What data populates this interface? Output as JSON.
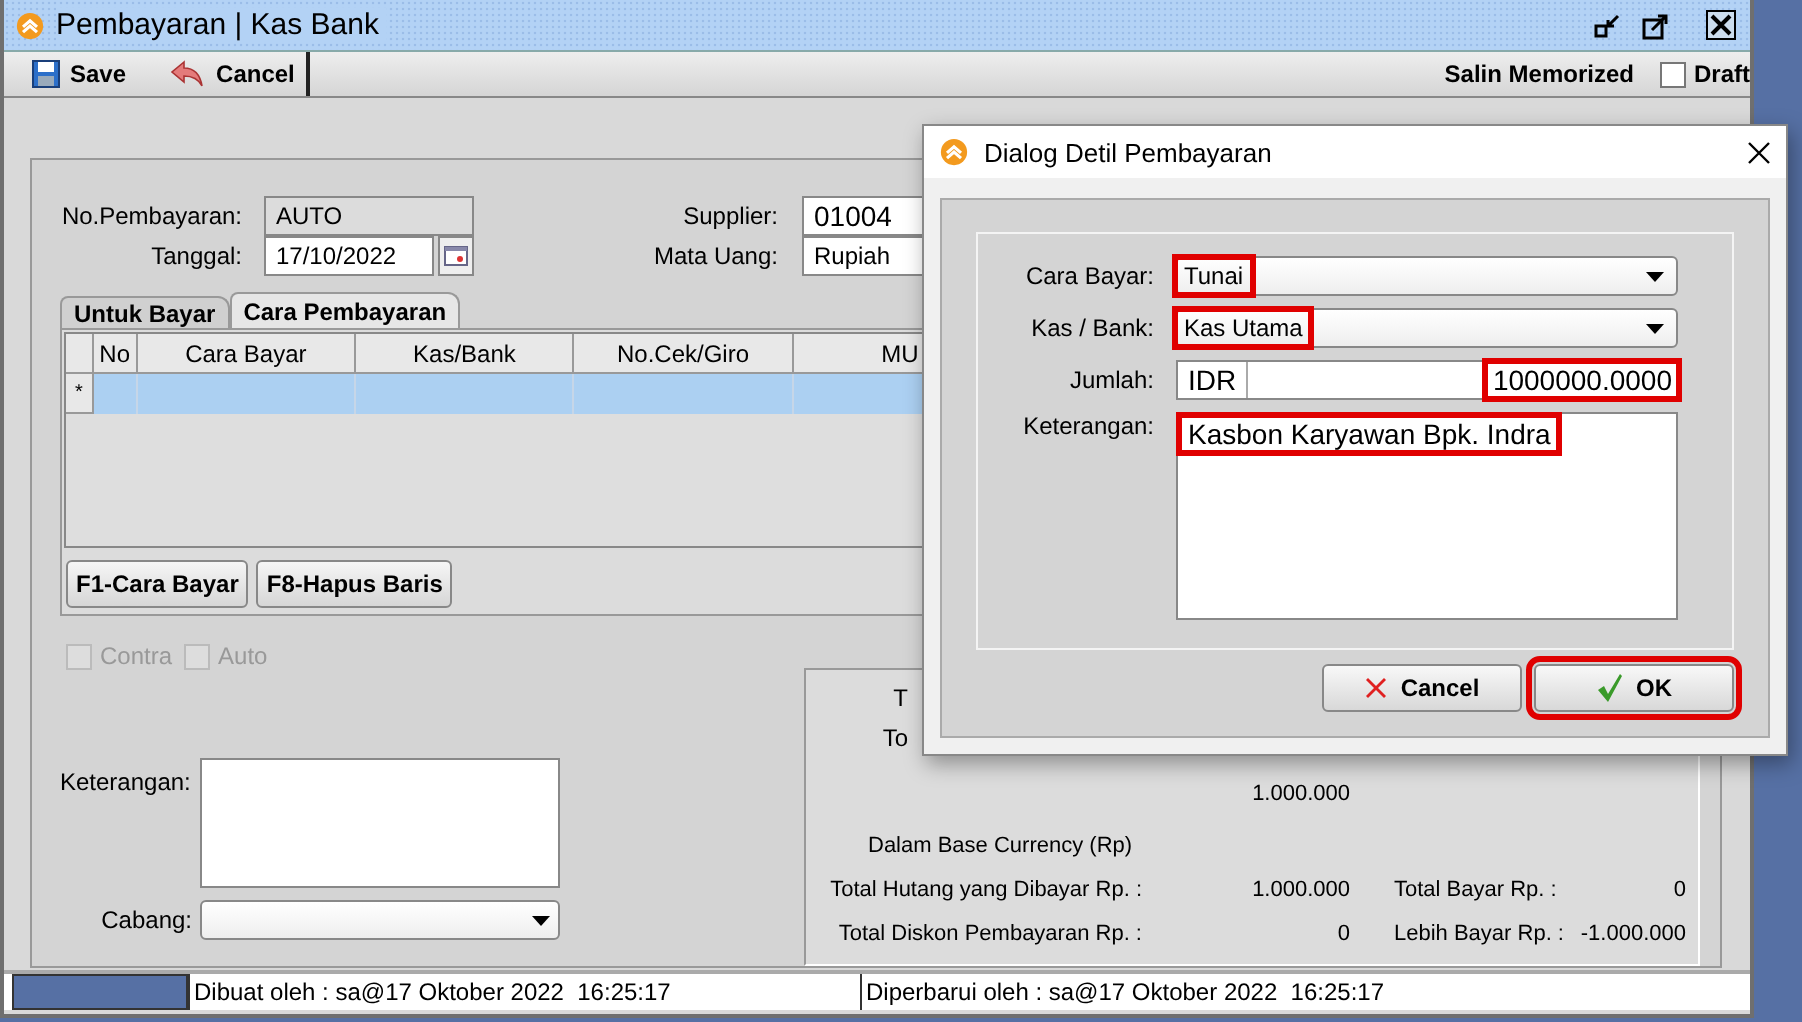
{
  "window": {
    "title": "Pembayaran | Kas Bank"
  },
  "toolbar": [
    {
      "label": "Save",
      "kind": "save"
    },
    {
      "label": "Cancel",
      "kind": "cancel"
    }
  ],
  "salin": "Salin Memorized",
  "draft": {
    "label": "Draft",
    "checked": false
  },
  "form": {
    "no_pembayaran": {
      "label": "No.Pembayaran:",
      "value": "AUTO"
    },
    "tanggal": {
      "label": "Tanggal:",
      "value": "17/10/2022"
    },
    "supplier": {
      "label": "Supplier:",
      "value": "01004"
    },
    "mata_uang": {
      "label": "Mata Uang:",
      "value": "Rupiah"
    }
  },
  "tabs": [
    {
      "label": "Untuk Bayar",
      "selected": false
    },
    {
      "label": "Cara Pembayaran",
      "selected": true
    }
  ],
  "table": {
    "columns": [
      "No",
      "Cara Bayar",
      "Kas/Bank",
      "No.Cek/Giro",
      "MU"
    ],
    "new_row_marker": "*"
  },
  "grid_buttons": [
    "F1-Cara Bayar",
    "F8-Hapus Baris"
  ],
  "options": [
    {
      "label": "Contra",
      "checked": false,
      "disabled": true
    },
    {
      "label": "Auto",
      "checked": false,
      "disabled": true
    }
  ],
  "keterangan": {
    "label": "Keterangan:"
  },
  "cabang": {
    "label": "Cabang:"
  },
  "totals": {
    "partial_labels": [
      "T",
      "To"
    ],
    "hidden_row_value": "1.000.000",
    "base_heading": "Dalam Base Currency (Rp)",
    "rows": [
      {
        "label": "Total Hutang yang Dibayar Rp. :",
        "value": "1.000.000",
        "label2": "Total Bayar Rp. :",
        "value2": "0"
      },
      {
        "label": "Total Diskon Pembayaran Rp. :",
        "value": "0",
        "label2": "Lebih Bayar Rp. :",
        "value2": "-1.000.000"
      }
    ]
  },
  "status_bar": [
    "Dibuat oleh : sa@17 Oktober 2022  16:25:17",
    "Diperbarui oleh : sa@17 Oktober 2022  16:25:17"
  ],
  "dialog": {
    "title": "Dialog Detil Pembayaran",
    "cara_bayar": {
      "label": "Cara Bayar:",
      "value": "Tunai",
      "highlighted": true
    },
    "kas_bank": {
      "label": "Kas / Bank:",
      "value": "Kas Utama",
      "highlighted": true
    },
    "jumlah": {
      "label": "Jumlah:",
      "currency": "IDR",
      "value": "1000000.0000",
      "highlighted": true
    },
    "keterangan": {
      "label": "Keterangan:",
      "value": "Kasbon Karyawan Bpk. Indra",
      "highlighted": true
    },
    "buttons": [
      {
        "label": "Cancel",
        "kind": "cancel",
        "highlighted": false
      },
      {
        "label": "OK",
        "kind": "ok",
        "highlighted": true
      }
    ]
  }
}
